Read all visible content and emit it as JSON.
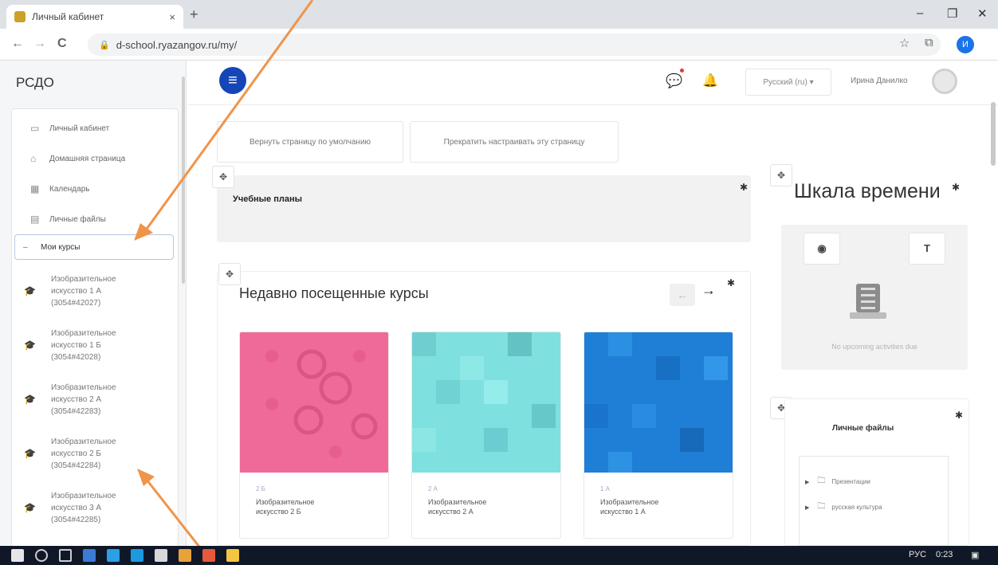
{
  "browser": {
    "tab_title": "Личный кабинет",
    "tab_close": "×",
    "new_tab": "+",
    "url": "d-school.ryazangov.ru/my/",
    "lock": "🔒",
    "back": "←",
    "forward": "→",
    "reload": "C",
    "profile_letter": "И",
    "win_min": "–",
    "win_max": "❐",
    "win_close": "✕"
  },
  "sidebar": {
    "site_name": "РСДО",
    "items": [
      {
        "label": "Личный кабинет",
        "icon": "dashboard-icon",
        "glyph": "▭"
      },
      {
        "label": "Домашняя страница",
        "icon": "home-icon",
        "glyph": "⌂"
      },
      {
        "label": "Календарь",
        "icon": "calendar-icon",
        "glyph": "▦"
      },
      {
        "label": "Личные файлы",
        "icon": "files-icon",
        "glyph": "▤"
      }
    ],
    "my_courses": "Мои курсы",
    "my_courses_toggle": "–",
    "courses": [
      {
        "l1": "Изобразительное",
        "l2": "искусство 1 А",
        "l3": "(3054#42027)"
      },
      {
        "l1": "Изобразительное",
        "l2": "искусство 1 Б",
        "l3": "(3054#42028)"
      },
      {
        "l1": "Изобразительное",
        "l2": "искусство 2 А",
        "l3": "(3054#42283)"
      },
      {
        "l1": "Изобразительное",
        "l2": "искусство 2 Б",
        "l3": "(3054#42284)"
      },
      {
        "l1": "Изобразительное",
        "l2": "искусство 3 А",
        "l3": "(3054#42285)"
      }
    ]
  },
  "header": {
    "menu": "≡",
    "messages_icon": "💬",
    "bell_icon": "🔔",
    "language": "Русский (ru) ▾",
    "user_name": "Ирина Данилко"
  },
  "main": {
    "reset_button": "Вернуть страницу по умолчанию",
    "stop_edit_button": "Прекратить настраивать эту страницу",
    "move_glyph": "✥",
    "gear_glyph": "✱",
    "plans_title": "Учебные планы",
    "recent_title": "Недавно посещенные курсы",
    "prev": "←",
    "next": "→",
    "cards": [
      {
        "sub": "2 Б",
        "title": "Изобразительное",
        "title2": "искусство 2 Б",
        "color": "#f06a99"
      },
      {
        "sub": "2 А",
        "title": "Изобразительное",
        "title2": "искусство 2 А",
        "color": "#7fe0e0"
      },
      {
        "sub": "1 А",
        "title": "Изобразительное",
        "title2": "искусство 1 А",
        "color": "#1f7fd6"
      }
    ]
  },
  "timeline": {
    "title": "Шкала времени",
    "sort_glyph": "◉",
    "filter_glyph": "T",
    "empty": "No upcoming activities due"
  },
  "files": {
    "title": "Личные файлы",
    "items": [
      {
        "name": "Презентации"
      },
      {
        "name": "русская культура"
      }
    ]
  },
  "taskbar": {
    "lang": "РУС",
    "time": "0:23"
  },
  "colors": {
    "accent": "#1546b8",
    "arrow": "#f0944a"
  }
}
